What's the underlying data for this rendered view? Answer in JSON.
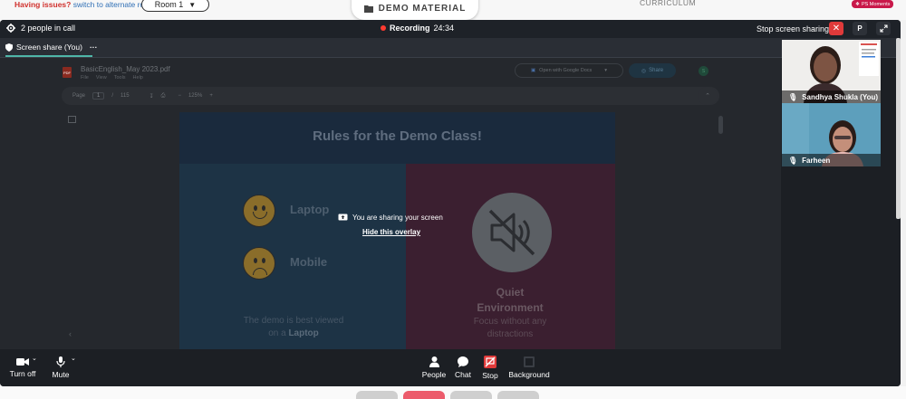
{
  "topbar": {
    "issues_label": "Having issues?",
    "alternate_label": "switch to alternate room",
    "room_label": "Room 1",
    "demo_material_label": "DEMO MATERIAL",
    "curriculum_label": "CURRICULUM",
    "moments_label": "PS Moments"
  },
  "call_header": {
    "people_label": "2 people in call",
    "recording_label": "Recording",
    "recording_time": "24:34",
    "stop_sharing_label": "Stop screen sharing",
    "avatar_initial": "P"
  },
  "tab": {
    "label": "Screen share (You)",
    "more": "···"
  },
  "pdf": {
    "title": "BasicEnglish_May 2023.pdf",
    "menu": [
      "File",
      "View",
      "Tools",
      "Help"
    ],
    "open_with": "Open with Google Docs",
    "share_label": "Share",
    "avatar_initial": "S",
    "page_label": "Page",
    "page_current": "1",
    "page_sep": "/",
    "page_total": "115",
    "zoom": "125%",
    "slide": {
      "title": "Rules for the Demo Class!",
      "laptop_label": "Laptop",
      "mobile_label": "Mobile",
      "bottom_left_1": "The demo is best viewed",
      "bottom_left_2_prefix": "on a",
      "bottom_left_2_bold": "Laptop",
      "quiet_title_1": "Quiet",
      "quiet_title_2": "Environment",
      "quiet_sub_1": "Focus without any",
      "quiet_sub_2": "distractions"
    }
  },
  "overlay": {
    "message": "You are sharing your screen",
    "hide_link": "Hide this overlay"
  },
  "participants": [
    {
      "name": "Sandhya Shukla (You)"
    },
    {
      "name": "Farheen"
    }
  ],
  "controls": {
    "turn_off": "Turn off",
    "mute": "Mute",
    "people": "People",
    "chat": "Chat",
    "stop": "Stop",
    "background": "Background"
  },
  "colors": {
    "stop_red": "#e03a3a",
    "accent_teal": "#4fb6a8",
    "call_bg": "#1c1f24"
  }
}
